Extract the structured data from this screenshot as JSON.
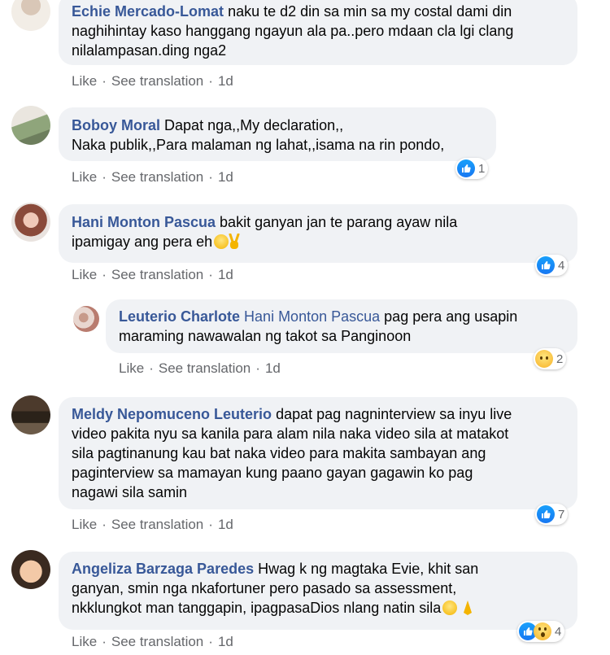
{
  "colors": {
    "author": "#385898",
    "bubble_bg": "#f0f2f5",
    "meta": "#65676b",
    "like_blue": "#1877f2"
  },
  "comments": [
    {
      "author": "Echie Mercado-Lomat",
      "line1": "naku te d2 din sa min sa my costal dami din",
      "line2": "naghihintay kaso hanggang ngayun ala pa..pero mdaan cla lgi clang",
      "line3": "nilalampasan.ding nga2",
      "like": "Like",
      "translate": "See translation",
      "time": "1d"
    },
    {
      "author": "Boboy Moral",
      "line1": "Dapat nga,,My declaration,,",
      "line2": "Naka publik,,Para malaman ng lahat,,isama na rin pondo,",
      "like": "Like",
      "translate": "See translation",
      "time": "1d",
      "reaction_count": "1"
    },
    {
      "author": "Hani Monton Pascua",
      "line1": "bakit ganyan jan te parang ayaw nila",
      "line2": "ipamigay ang pera eh",
      "like": "Like",
      "translate": "See translation",
      "time": "1d",
      "reaction_count": "4"
    },
    {
      "author": "Leuterio Charlote",
      "mention": "Hani Monton Pascua",
      "line1": "pag pera ang usapin",
      "line2": "maraming nawawalan ng takot sa Panginoon",
      "like": "Like",
      "translate": "See translation",
      "time": "1d",
      "reaction_count": "2"
    },
    {
      "author": "Meldy Nepomuceno Leuterio",
      "line1": "dapat pag nagninterview sa inyu live",
      "line2": "video pakita nyu sa kanila para alam nila naka video sila at matakot",
      "line3": "sila pagtinanung kau bat naka video para makita sambayan ang",
      "line4": "paginterview sa mamayan kung paano gayan gagawin ko pag",
      "line5": "nagawi sila samin",
      "like": "Like",
      "translate": "See translation",
      "time": "1d",
      "reaction_count": "7"
    },
    {
      "author": "Angeliza Barzaga Paredes",
      "line1": "Hwag k ng magtaka Evie, khit san",
      "line2": "ganyan, smin nga nkafortuner pero pasado sa assessment,",
      "line3": "nkklungkot man tanggapin, ipagpasaDios nlang natin sila",
      "like": "Like",
      "translate": "See translation",
      "time": "1d",
      "reaction_count": "4"
    }
  ],
  "separator": "·"
}
